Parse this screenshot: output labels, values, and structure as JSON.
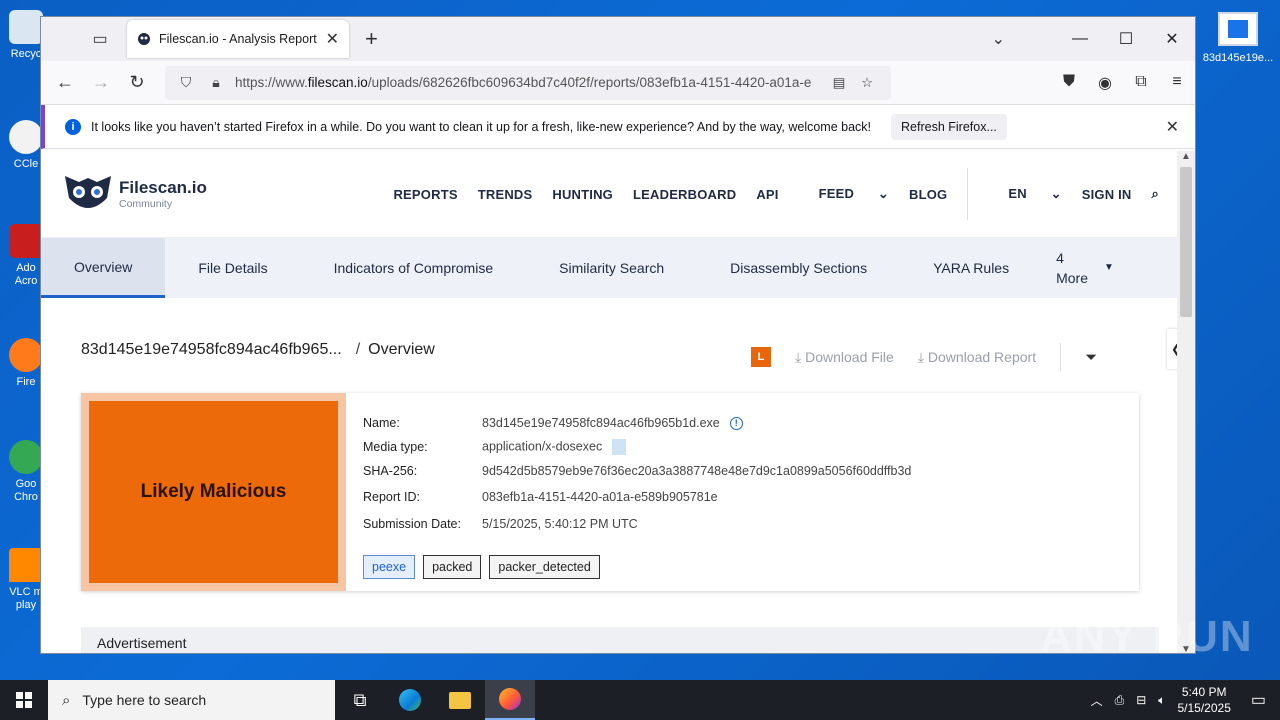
{
  "desktop": {
    "left_icons": [
      "Recycle",
      "CCleaner",
      "Adobe Acrobat",
      "Firefox",
      "Google Chrome",
      "VLC media player"
    ],
    "left_icon_labels_visible": [
      "Recyc",
      "CCle",
      "Ado Acro",
      "Fire",
      "Goo Chro",
      "VLC m play"
    ],
    "right_icon_label": "83d145e19e..."
  },
  "browser": {
    "tab_title": "Filescan.io - Analysis Report for",
    "url_prefix": "https://www.",
    "url_domain": "filescan.io",
    "url_rest": "/uploads/682626fbc609634bd7c40f2f/reports/083efb1a-4151-4420-a01a-e"
  },
  "notification": {
    "message": "It looks like you haven’t started Firefox in a while. Do you want to clean it up for a fresh, like-new experience? And by the way, welcome back!",
    "button": "Refresh Firefox..."
  },
  "site": {
    "brand": "Filescan.io",
    "brand_sub": "Community",
    "nav": [
      "REPORTS",
      "TRENDS",
      "HUNTING",
      "LEADERBOARD",
      "API",
      "FEED",
      "BLOG"
    ],
    "lang": "EN",
    "sign_in": "SIGN IN"
  },
  "subtabs": [
    "Overview",
    "File Details",
    "Indicators of Compromise",
    "Similarity Search",
    "Disassembly Sections",
    "YARA Rules"
  ],
  "more_tabs": {
    "count": "4",
    "label": "More"
  },
  "breadcrumb": {
    "file": "83d145e19e74958fc894ac46fb965...",
    "section": "Overview"
  },
  "actions": {
    "badge": "L",
    "download_file": "Download File",
    "download_report": "Download Report"
  },
  "report": {
    "verdict": "Likely Malicious",
    "name_label": "Name:",
    "name": "83d145e19e74958fc894ac46fb965b1d.exe",
    "media_label": "Media type:",
    "media": "application/x-dosexec",
    "sha_label": "SHA-256:",
    "sha": "9d542d5b8579eb9e76f36ec20a3a3887748e48e7d9c1a0899a5056f60ddffb3d",
    "rid_label": "Report ID:",
    "rid": "083efb1a-4151-4420-a01a-e589b905781e",
    "date_label": "Submission Date:",
    "date": "5/15/2025, 5:40:12 PM UTC",
    "tags": [
      "peexe",
      "packed",
      "packer_detected"
    ]
  },
  "advertisement": "Advertisement",
  "taskbar": {
    "search_placeholder": "Type here to search",
    "time": "5:40 PM",
    "date": "5/15/2025"
  },
  "watermark": "ANY RUN",
  "colors": {
    "verdict": "#ed6a0b",
    "accent": "#1f62c9",
    "taskbar": "#1c1f26"
  }
}
